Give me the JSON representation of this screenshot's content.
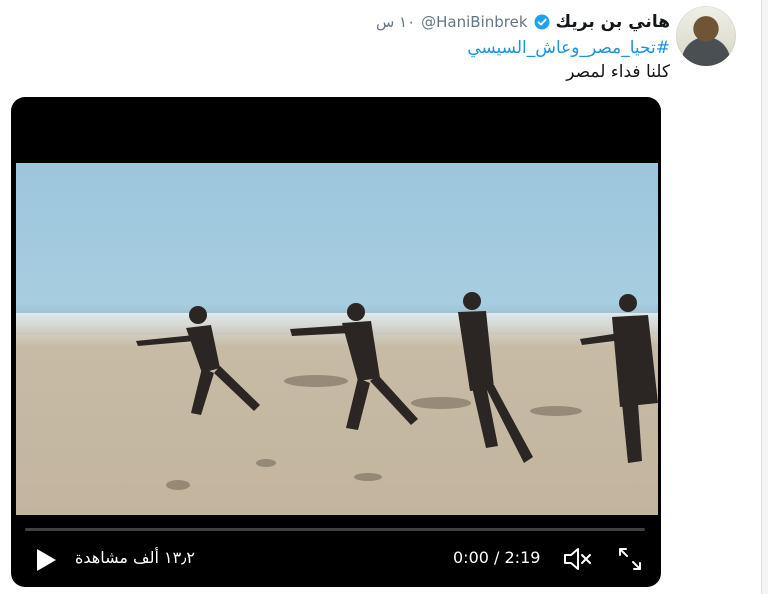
{
  "tweet": {
    "author_name": "هاني بن بريك",
    "handle": "@HaniBinbrek",
    "time": "١٠ س",
    "hashtag": "#تحيا_مصر_وعاش_السيسي",
    "text": "كلنا فداء لمصر",
    "verified_icon": "verified-badge-icon",
    "colors": {
      "link": "#1b95e0",
      "name": "#14171a",
      "muted": "#657786",
      "verified": "#1da1f2"
    }
  },
  "video": {
    "views": "١٣٫٢ ألف مشاهدة",
    "time_display": "0:00 / 2:19",
    "progress": 0,
    "play_icon": "play-icon",
    "mute_icon": "muted-speaker-icon",
    "fullscreen_icon": "fullscreen-icon"
  }
}
